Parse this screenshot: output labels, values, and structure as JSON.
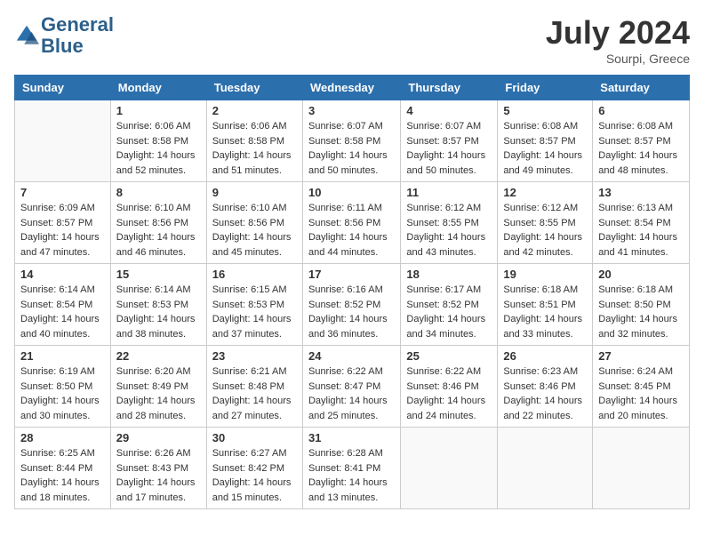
{
  "header": {
    "logo_line1": "General",
    "logo_line2": "Blue",
    "month_year": "July 2024",
    "location": "Sourpi, Greece"
  },
  "weekdays": [
    "Sunday",
    "Monday",
    "Tuesday",
    "Wednesday",
    "Thursday",
    "Friday",
    "Saturday"
  ],
  "weeks": [
    [
      {
        "day": "",
        "info": ""
      },
      {
        "day": "1",
        "info": "Sunrise: 6:06 AM\nSunset: 8:58 PM\nDaylight: 14 hours\nand 52 minutes."
      },
      {
        "day": "2",
        "info": "Sunrise: 6:06 AM\nSunset: 8:58 PM\nDaylight: 14 hours\nand 51 minutes."
      },
      {
        "day": "3",
        "info": "Sunrise: 6:07 AM\nSunset: 8:58 PM\nDaylight: 14 hours\nand 50 minutes."
      },
      {
        "day": "4",
        "info": "Sunrise: 6:07 AM\nSunset: 8:57 PM\nDaylight: 14 hours\nand 50 minutes."
      },
      {
        "day": "5",
        "info": "Sunrise: 6:08 AM\nSunset: 8:57 PM\nDaylight: 14 hours\nand 49 minutes."
      },
      {
        "day": "6",
        "info": "Sunrise: 6:08 AM\nSunset: 8:57 PM\nDaylight: 14 hours\nand 48 minutes."
      }
    ],
    [
      {
        "day": "7",
        "info": "Sunrise: 6:09 AM\nSunset: 8:57 PM\nDaylight: 14 hours\nand 47 minutes."
      },
      {
        "day": "8",
        "info": "Sunrise: 6:10 AM\nSunset: 8:56 PM\nDaylight: 14 hours\nand 46 minutes."
      },
      {
        "day": "9",
        "info": "Sunrise: 6:10 AM\nSunset: 8:56 PM\nDaylight: 14 hours\nand 45 minutes."
      },
      {
        "day": "10",
        "info": "Sunrise: 6:11 AM\nSunset: 8:56 PM\nDaylight: 14 hours\nand 44 minutes."
      },
      {
        "day": "11",
        "info": "Sunrise: 6:12 AM\nSunset: 8:55 PM\nDaylight: 14 hours\nand 43 minutes."
      },
      {
        "day": "12",
        "info": "Sunrise: 6:12 AM\nSunset: 8:55 PM\nDaylight: 14 hours\nand 42 minutes."
      },
      {
        "day": "13",
        "info": "Sunrise: 6:13 AM\nSunset: 8:54 PM\nDaylight: 14 hours\nand 41 minutes."
      }
    ],
    [
      {
        "day": "14",
        "info": "Sunrise: 6:14 AM\nSunset: 8:54 PM\nDaylight: 14 hours\nand 40 minutes."
      },
      {
        "day": "15",
        "info": "Sunrise: 6:14 AM\nSunset: 8:53 PM\nDaylight: 14 hours\nand 38 minutes."
      },
      {
        "day": "16",
        "info": "Sunrise: 6:15 AM\nSunset: 8:53 PM\nDaylight: 14 hours\nand 37 minutes."
      },
      {
        "day": "17",
        "info": "Sunrise: 6:16 AM\nSunset: 8:52 PM\nDaylight: 14 hours\nand 36 minutes."
      },
      {
        "day": "18",
        "info": "Sunrise: 6:17 AM\nSunset: 8:52 PM\nDaylight: 14 hours\nand 34 minutes."
      },
      {
        "day": "19",
        "info": "Sunrise: 6:18 AM\nSunset: 8:51 PM\nDaylight: 14 hours\nand 33 minutes."
      },
      {
        "day": "20",
        "info": "Sunrise: 6:18 AM\nSunset: 8:50 PM\nDaylight: 14 hours\nand 32 minutes."
      }
    ],
    [
      {
        "day": "21",
        "info": "Sunrise: 6:19 AM\nSunset: 8:50 PM\nDaylight: 14 hours\nand 30 minutes."
      },
      {
        "day": "22",
        "info": "Sunrise: 6:20 AM\nSunset: 8:49 PM\nDaylight: 14 hours\nand 28 minutes."
      },
      {
        "day": "23",
        "info": "Sunrise: 6:21 AM\nSunset: 8:48 PM\nDaylight: 14 hours\nand 27 minutes."
      },
      {
        "day": "24",
        "info": "Sunrise: 6:22 AM\nSunset: 8:47 PM\nDaylight: 14 hours\nand 25 minutes."
      },
      {
        "day": "25",
        "info": "Sunrise: 6:22 AM\nSunset: 8:46 PM\nDaylight: 14 hours\nand 24 minutes."
      },
      {
        "day": "26",
        "info": "Sunrise: 6:23 AM\nSunset: 8:46 PM\nDaylight: 14 hours\nand 22 minutes."
      },
      {
        "day": "27",
        "info": "Sunrise: 6:24 AM\nSunset: 8:45 PM\nDaylight: 14 hours\nand 20 minutes."
      }
    ],
    [
      {
        "day": "28",
        "info": "Sunrise: 6:25 AM\nSunset: 8:44 PM\nDaylight: 14 hours\nand 18 minutes."
      },
      {
        "day": "29",
        "info": "Sunrise: 6:26 AM\nSunset: 8:43 PM\nDaylight: 14 hours\nand 17 minutes."
      },
      {
        "day": "30",
        "info": "Sunrise: 6:27 AM\nSunset: 8:42 PM\nDaylight: 14 hours\nand 15 minutes."
      },
      {
        "day": "31",
        "info": "Sunrise: 6:28 AM\nSunset: 8:41 PM\nDaylight: 14 hours\nand 13 minutes."
      },
      {
        "day": "",
        "info": ""
      },
      {
        "day": "",
        "info": ""
      },
      {
        "day": "",
        "info": ""
      }
    ]
  ]
}
